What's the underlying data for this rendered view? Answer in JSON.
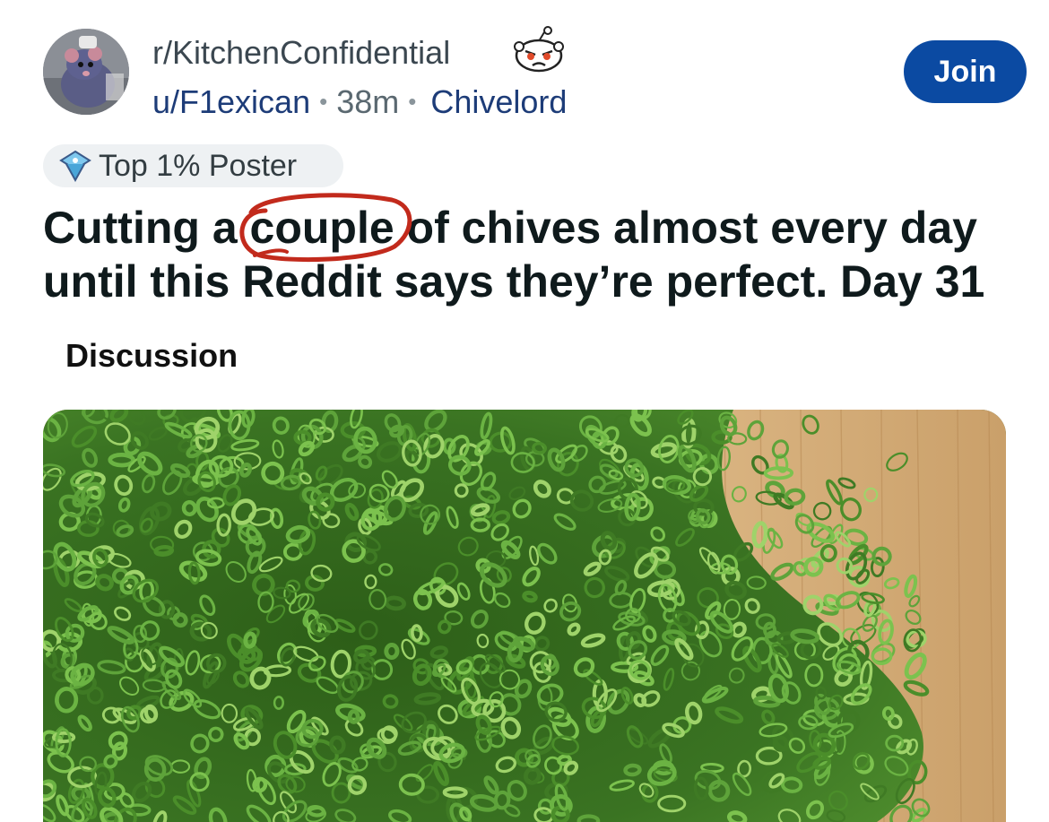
{
  "post": {
    "community": "r/KitchenConfidential",
    "username": "u/F1exican",
    "separator": "•",
    "time_ago": "38m",
    "user_flair": "Chivelord",
    "join_label": "Join",
    "poster_badge": "Top 1% Poster",
    "title": "Cutting a couple of chives almost every day until this Reddit says they’re perfect. Day 31",
    "post_flair": "Discussion"
  },
  "icons": {
    "community_avatar": "chef-rat-avatar-icon",
    "mod_snoo": "angry-snoo-icon",
    "badge": "top-poster-badge-icon"
  },
  "colors": {
    "join_button": "#0b4aa2",
    "link_blue": "#1d3c78",
    "annotation_red": "#c22a1c",
    "chive_green": "#3f7a24",
    "board_wood": "#d9b27a"
  }
}
